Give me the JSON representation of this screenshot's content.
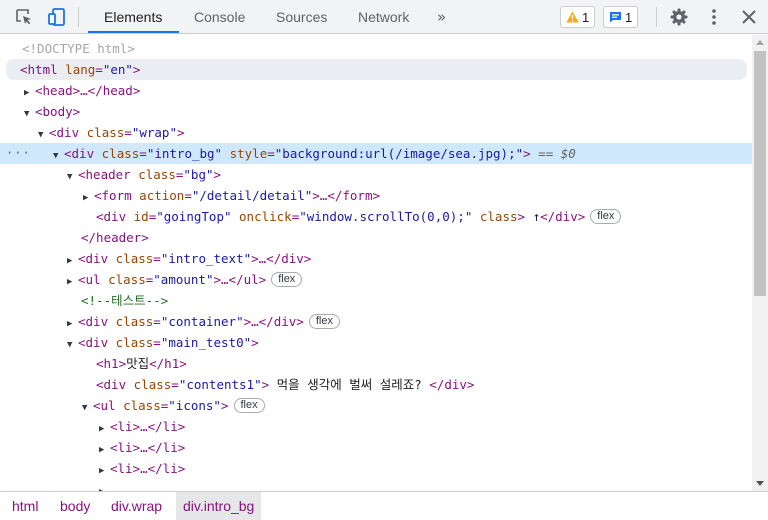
{
  "toolbar": {
    "icons": [
      "inspect-element-icon",
      "device-toolbar-icon",
      "more-tabs-icon",
      "warning-icon",
      "issues-icon",
      "gear-icon",
      "kebab-menu-icon",
      "close-icon"
    ],
    "tabs": [
      {
        "label": "Elements",
        "active": true
      },
      {
        "label": "Console"
      },
      {
        "label": "Sources"
      },
      {
        "label": "Network"
      }
    ],
    "more_tabs": "»",
    "warnings_count": "1",
    "issues_count": "1",
    "colors": {
      "active_tab_underline": "#1a73e8",
      "warning": "#f9ab00",
      "issues": "#1a73e8"
    }
  },
  "dom_tree": {
    "doctype": "<!DOCTYPE html>",
    "html_tag": "html",
    "lang_attr": "lang",
    "lang_value": "\"en\"",
    "head_collapsed": "<head>…</head>",
    "body_tag": "<body>",
    "wrap": {
      "tag": "<div",
      "attr": "class",
      "value": "\"wrap\""
    },
    "intro_bg": {
      "tag": "<div",
      "class_attr": "class",
      "class_value": "\"intro_bg\"",
      "style_attr": "style",
      "style_value": "\"background:url(/image/sea.jpg);\"",
      "selected_marker": "== $0",
      "row_dots": "···"
    },
    "header": {
      "tag": "<header",
      "attr": "class",
      "value": "\"bg\""
    },
    "form": {
      "tag": "<form",
      "attr": "action",
      "value": "\"/detail/detail\"",
      "rest": ">…</form>"
    },
    "going_top": {
      "tag": "<div",
      "id_attr": "id",
      "id_value": "\"goingTop\"",
      "onclick_attr": "onclick",
      "onclick_value": "\"window.scrollTo(0,0);\"",
      "class_attr": "class",
      "text": "↑",
      "close": "</div>",
      "badge": "flex"
    },
    "header_close": "</header>",
    "intro_text": {
      "tag": "<div",
      "attr": "class",
      "value": "\"intro_text\"",
      "rest": ">…</div>"
    },
    "amount": {
      "tag": "<ul",
      "attr": "class",
      "value": "\"amount\"",
      "rest": ">…</ul>",
      "badge": "flex"
    },
    "comment": "<!--테스트-->",
    "container": {
      "tag": "<div",
      "attr": "class",
      "value": "\"container\"",
      "rest": ">…</div>",
      "badge": "flex"
    },
    "main_test0": {
      "tag": "<div",
      "attr": "class",
      "value": "\"main_test0\""
    },
    "h1": {
      "open": "<h1>",
      "text": "맛집",
      "close": "</h1>"
    },
    "contents1": {
      "tag": "<div",
      "attr": "class",
      "value": "\"contents1\"",
      "text": " 먹을 생각에 벌써 설레죠? ",
      "close": "</div>"
    },
    "icons_ul": {
      "tag": "<ul",
      "attr": "class",
      "value": "\"icons\"",
      "badge": "flex"
    },
    "li_items": [
      "<li>…</li>",
      "<li>…</li>",
      "<li>…</li>"
    ]
  },
  "breadcrumbs": [
    {
      "label": "html"
    },
    {
      "label": "body"
    },
    {
      "label": "div.wrap"
    },
    {
      "label": "div.intro_bg",
      "active": true
    }
  ]
}
